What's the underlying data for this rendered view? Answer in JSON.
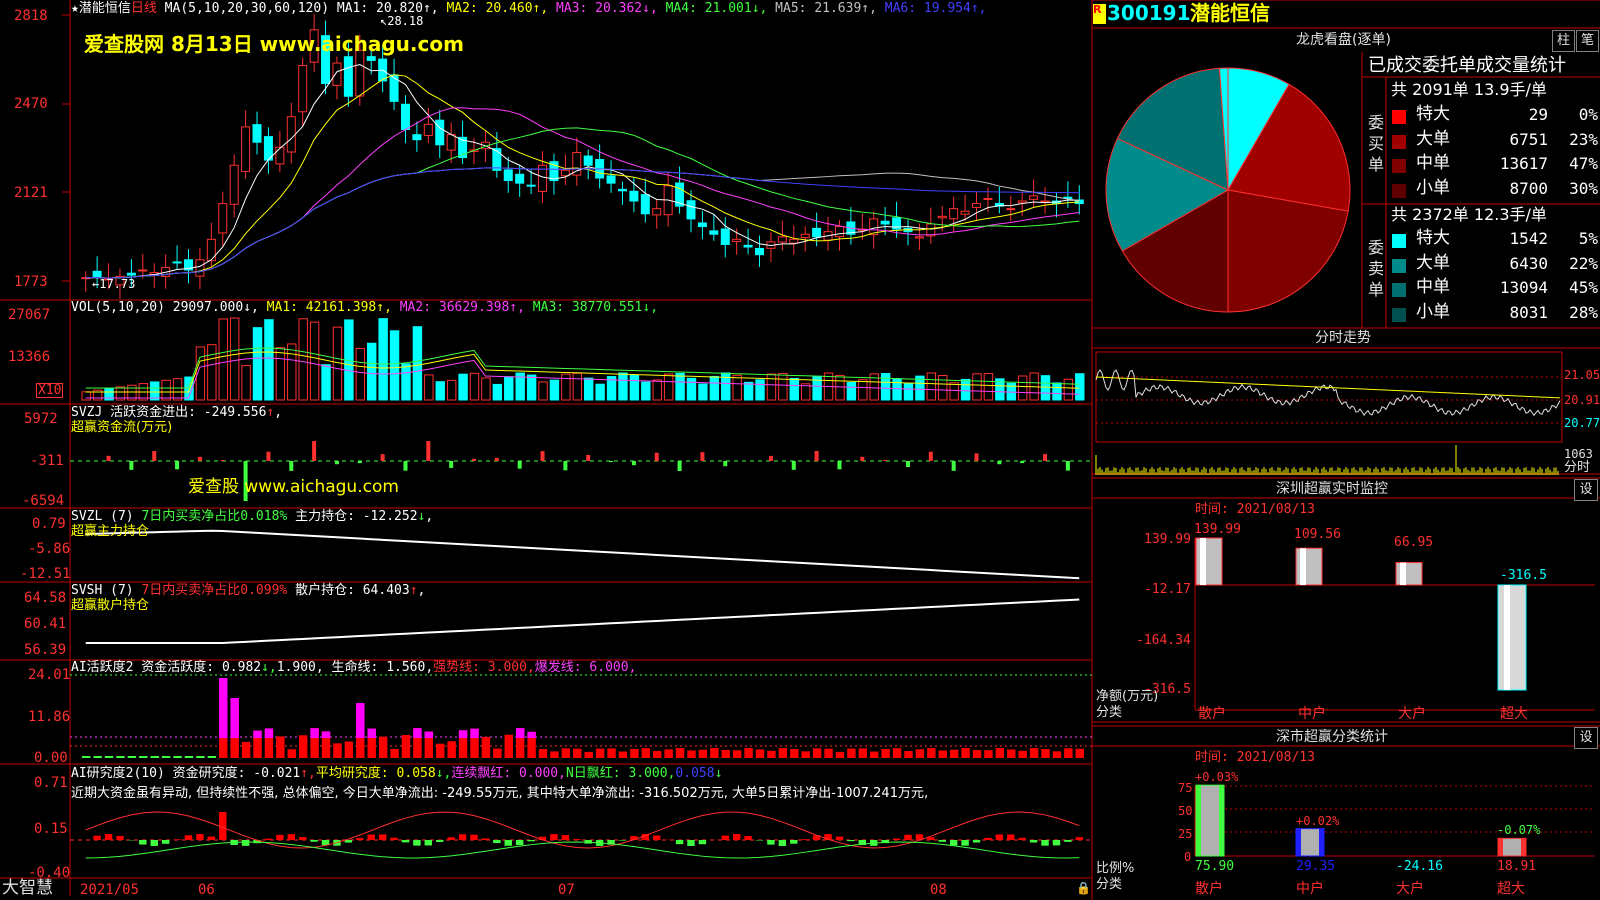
{
  "main": {
    "title_prefix": "★潜能恒信",
    "period": "日线",
    "ma_params": "MA(5,10,20,30,60,120)",
    "ma_values": [
      {
        "label": "MA1: 20.820",
        "arrow": "↑",
        "color": "#ffffff"
      },
      {
        "label": "MA2: 20.460",
        "arrow": "↑",
        "color": "#ffff00"
      },
      {
        "label": "MA3: 20.362",
        "arrow": "↓",
        "color": "#ff40ff"
      },
      {
        "label": "MA4: 21.001",
        "arrow": "↓",
        "color": "#40ff40"
      },
      {
        "label": "MA5: 21.639",
        "arrow": "↑",
        "color": "#c0c0c0"
      },
      {
        "label": "MA6: 19.954",
        "arrow": "↑",
        "color": "#4040ff"
      }
    ],
    "watermark": "爱查股网    8月13日    www.aichagu.com",
    "high_label": "28.18",
    "low_label": "17.73",
    "price_ticks": [
      "2818",
      "2470",
      "2121",
      "1773"
    ],
    "vol_title": "VOL(5,10,20)",
    "vol_values": [
      {
        "label": "29097.000",
        "arrow": "↓",
        "color": "#ffffff"
      },
      {
        "label": "MA1: 42161.398",
        "arrow": "↑",
        "color": "#ffff00"
      },
      {
        "label": "MA2: 36629.398",
        "arrow": "↑",
        "color": "#ff40ff"
      },
      {
        "label": "MA3: 38770.551",
        "arrow": "↓",
        "color": "#40ff40"
      }
    ],
    "vol_ticks": [
      "27067",
      "13366"
    ],
    "vol_unit": "X10",
    "svzj_title": "SVZJ  活跃资金进出: -249.556",
    "svzj_arrow": "↑",
    "svzj_sub": "超赢资金流(万元)",
    "svzj_ticks": [
      "5972",
      "-311",
      "-6594"
    ],
    "svzj_watermark": "爱查股 www.aichagu.com",
    "svzl_title": "SVZL (7)",
    "svzl_mid": "7日内买卖净占比0.018%",
    "svzl_rest": "主力持仓: -12.252",
    "svzl_arrow": "↓",
    "svzl_sub": "超赢主力持仓",
    "svzl_ticks": [
      "0.79",
      "-5.86",
      "-12.51"
    ],
    "svsh_title": "SVSH (7)",
    "svsh_mid": "7日内买卖净占比0.099%",
    "svsh_rest": "散户持仓: 64.403",
    "svsh_arrow": "↑",
    "svsh_sub": "超赢散户持仓",
    "svsh_ticks": [
      "64.58",
      "60.41",
      "56.39"
    ],
    "ai1_title": "AI活跃度2 资金活跃度: 0.982",
    "ai1_parts": [
      {
        "label": "↓,",
        "color": "#40ff40"
      },
      {
        "label": "1.900, 生命线: 1.560,",
        "color": "#ffffff"
      },
      {
        "label": "强势线: 3.000,",
        "color": "#ff3030"
      },
      {
        "label": "爆发线: 6.000,",
        "color": "#ff40ff"
      }
    ],
    "ai1_ticks": [
      "24.01",
      "11.86",
      "0.00"
    ],
    "ai2_title": "AI研究度2(10) 资金研究度: -0.021",
    "ai2_parts": [
      {
        "label": "↑,",
        "color": "#ff3030"
      },
      {
        "label": "平均研究度: 0.058",
        "color": "#ffff00"
      },
      {
        "label": "↓,",
        "color": "#40ff40"
      },
      {
        "label": "连续飘红: 0.000,",
        "color": "#ff40ff"
      },
      {
        "label": "N日飘红: 3.000,",
        "color": "#40ff40"
      },
      {
        "label": "0.058",
        "color": "#4040ff"
      },
      {
        "label": "↓",
        "color": "#40ff40"
      }
    ],
    "ai2_comment": "近期大资金虽有异动, 但持续性不强, 总体偏空, 今日大单净流出: -249.55万元, 其中特大单净流出: -316.502万元, 大单5日累计净出-1007.241万元,",
    "ai2_ticks": [
      "0.71",
      "0.15",
      "-0.40"
    ],
    "date_labels": [
      "2021/05",
      "06",
      "07",
      "08"
    ],
    "brand": "大智慧"
  },
  "side": {
    "r_badge": "R",
    "code": "300191",
    "name": "潜能恒信",
    "dragon_title": "龙虎看盘(逐单)",
    "tab_col": "柱",
    "tab_pen": "笔",
    "stats_title": "已成交委托单成交量统计",
    "buy_label": "委买单",
    "sell_label": "委卖单",
    "buy_total": "共 2091单 13.9手/单",
    "sell_total": "共 2372单 12.3手/单",
    "buy_rows": [
      {
        "label": "特大",
        "value": "29",
        "pct": "0%",
        "color": "#ff0000"
      },
      {
        "label": "大单",
        "value": "6751",
        "pct": "23%",
        "color": "#a00000"
      },
      {
        "label": "中单",
        "value": "13617",
        "pct": "47%",
        "color": "#800000"
      },
      {
        "label": "小单",
        "value": "8700",
        "pct": "30%",
        "color": "#600000"
      }
    ],
    "sell_rows": [
      {
        "label": "特大",
        "value": "1542",
        "pct": "5%",
        "color": "#00ffff"
      },
      {
        "label": "大单",
        "value": "6430",
        "pct": "22%",
        "color": "#008b8b"
      },
      {
        "label": "中单",
        "value": "13094",
        "pct": "45%",
        "color": "#007070"
      },
      {
        "label": "小单",
        "value": "8031",
        "pct": "28%",
        "color": "#005050"
      }
    ],
    "intraday_title": "分时走势",
    "intraday_ticks": [
      "21.05",
      "20.91",
      "20.77"
    ],
    "intraday_vol": "1063",
    "intraday_label": "分时",
    "monitor_title": "深圳超赢实时监控",
    "monitor_time": "时间: 2021/08/13",
    "monitor_set": "设",
    "monitor_ticks": [
      "139.99",
      "-12.17",
      "-164.34",
      "-316.5"
    ],
    "monitor_values": [
      {
        "label": "139.99",
        "value": 139.99,
        "cat": "散户"
      },
      {
        "label": "109.56",
        "value": 109.56,
        "cat": "中户"
      },
      {
        "label": "66.95",
        "value": 66.95,
        "cat": "大户"
      },
      {
        "label": "-316.5",
        "value": -316.5,
        "cat": "超大"
      }
    ],
    "monitor_unit": "净额(万元)",
    "monitor_cat": "分类",
    "class_title": "深市超赢分类统计",
    "class_time": "时间: 2021/08/13",
    "class_set": "设",
    "class_ticks": [
      "75",
      "50",
      "25",
      "0"
    ],
    "class_values": [
      {
        "delta": "+0.03%",
        "value": 75.9,
        "label": "75.90",
        "cat": "散户",
        "color": "#40ff40"
      },
      {
        "delta": "+0.02%",
        "value": 29.35,
        "label": "29.35",
        "cat": "中户",
        "color": "#2020ff"
      },
      {
        "delta": "-24.16",
        "value": 0,
        "label": "-24.16",
        "cat": "大户",
        "color": "#00ffff"
      },
      {
        "delta": "-0.07%",
        "value": 18.91,
        "label": "18.91",
        "cat": "超大",
        "color": "#ff3030"
      }
    ],
    "class_unit": "比例%",
    "class_cat": "分类"
  }
}
